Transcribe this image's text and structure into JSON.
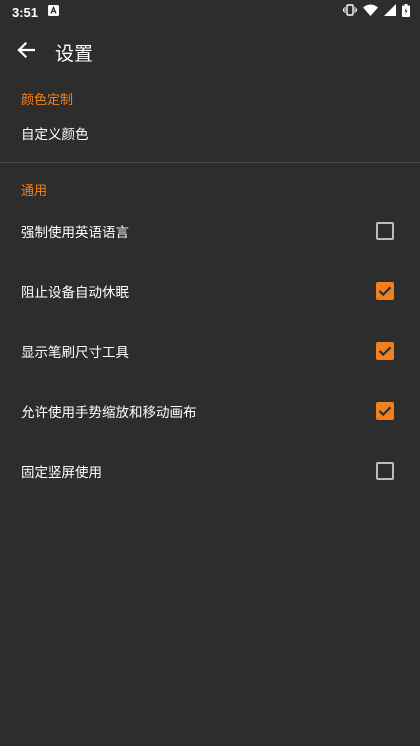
{
  "status_bar": {
    "time": "3:51",
    "notification_icon": "a-letter-icon",
    "icons": [
      "vibrate-icon",
      "wifi-icon",
      "signal-icon",
      "battery-icon"
    ]
  },
  "toolbar": {
    "title": "设置",
    "back_icon": "arrow-back-icon"
  },
  "sections": {
    "color": {
      "header": "颜色定制",
      "items": [
        {
          "label": "自定义颜色"
        }
      ]
    },
    "general": {
      "header": "通用",
      "items": [
        {
          "label": "强制使用英语语言",
          "checked": false
        },
        {
          "label": "阻止设备自动休眠",
          "checked": true
        },
        {
          "label": "显示笔刷尺寸工具",
          "checked": true
        },
        {
          "label": "允许使用手势缩放和移动画布",
          "checked": true
        },
        {
          "label": "固定竖屏使用",
          "checked": false
        }
      ]
    }
  },
  "colors": {
    "accent": "#f3801f",
    "background": "#2d2d2d",
    "text": "#ffffff"
  }
}
